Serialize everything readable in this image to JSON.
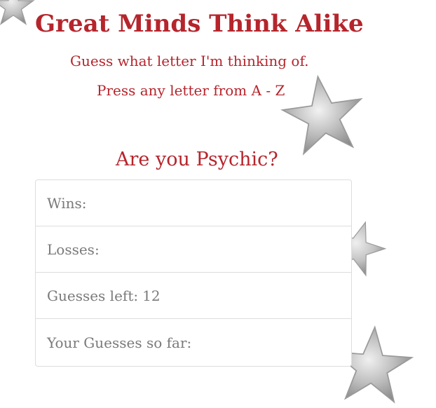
{
  "header": {
    "title": "Great Minds Think Alike",
    "instruction": "Guess what letter I'm thinking of.",
    "prompt": "Press any letter from A - Z"
  },
  "game": {
    "heading": "Are you Psychic?",
    "stats": {
      "wins_label": "Wins:",
      "wins_value": "",
      "losses_label": "Losses:",
      "losses_value": "",
      "guesses_left_label": "Guesses left:",
      "guesses_left_value": "12",
      "guesses_so_far_label": "Your Guesses so far:",
      "guesses_so_far_value": ""
    }
  },
  "colors": {
    "accent": "#b5252c",
    "stat_text": "#7a7a7a",
    "star": "#b9b9b9"
  },
  "decorations": [
    "star-icon",
    "star-icon",
    "star-icon",
    "star-icon"
  ]
}
